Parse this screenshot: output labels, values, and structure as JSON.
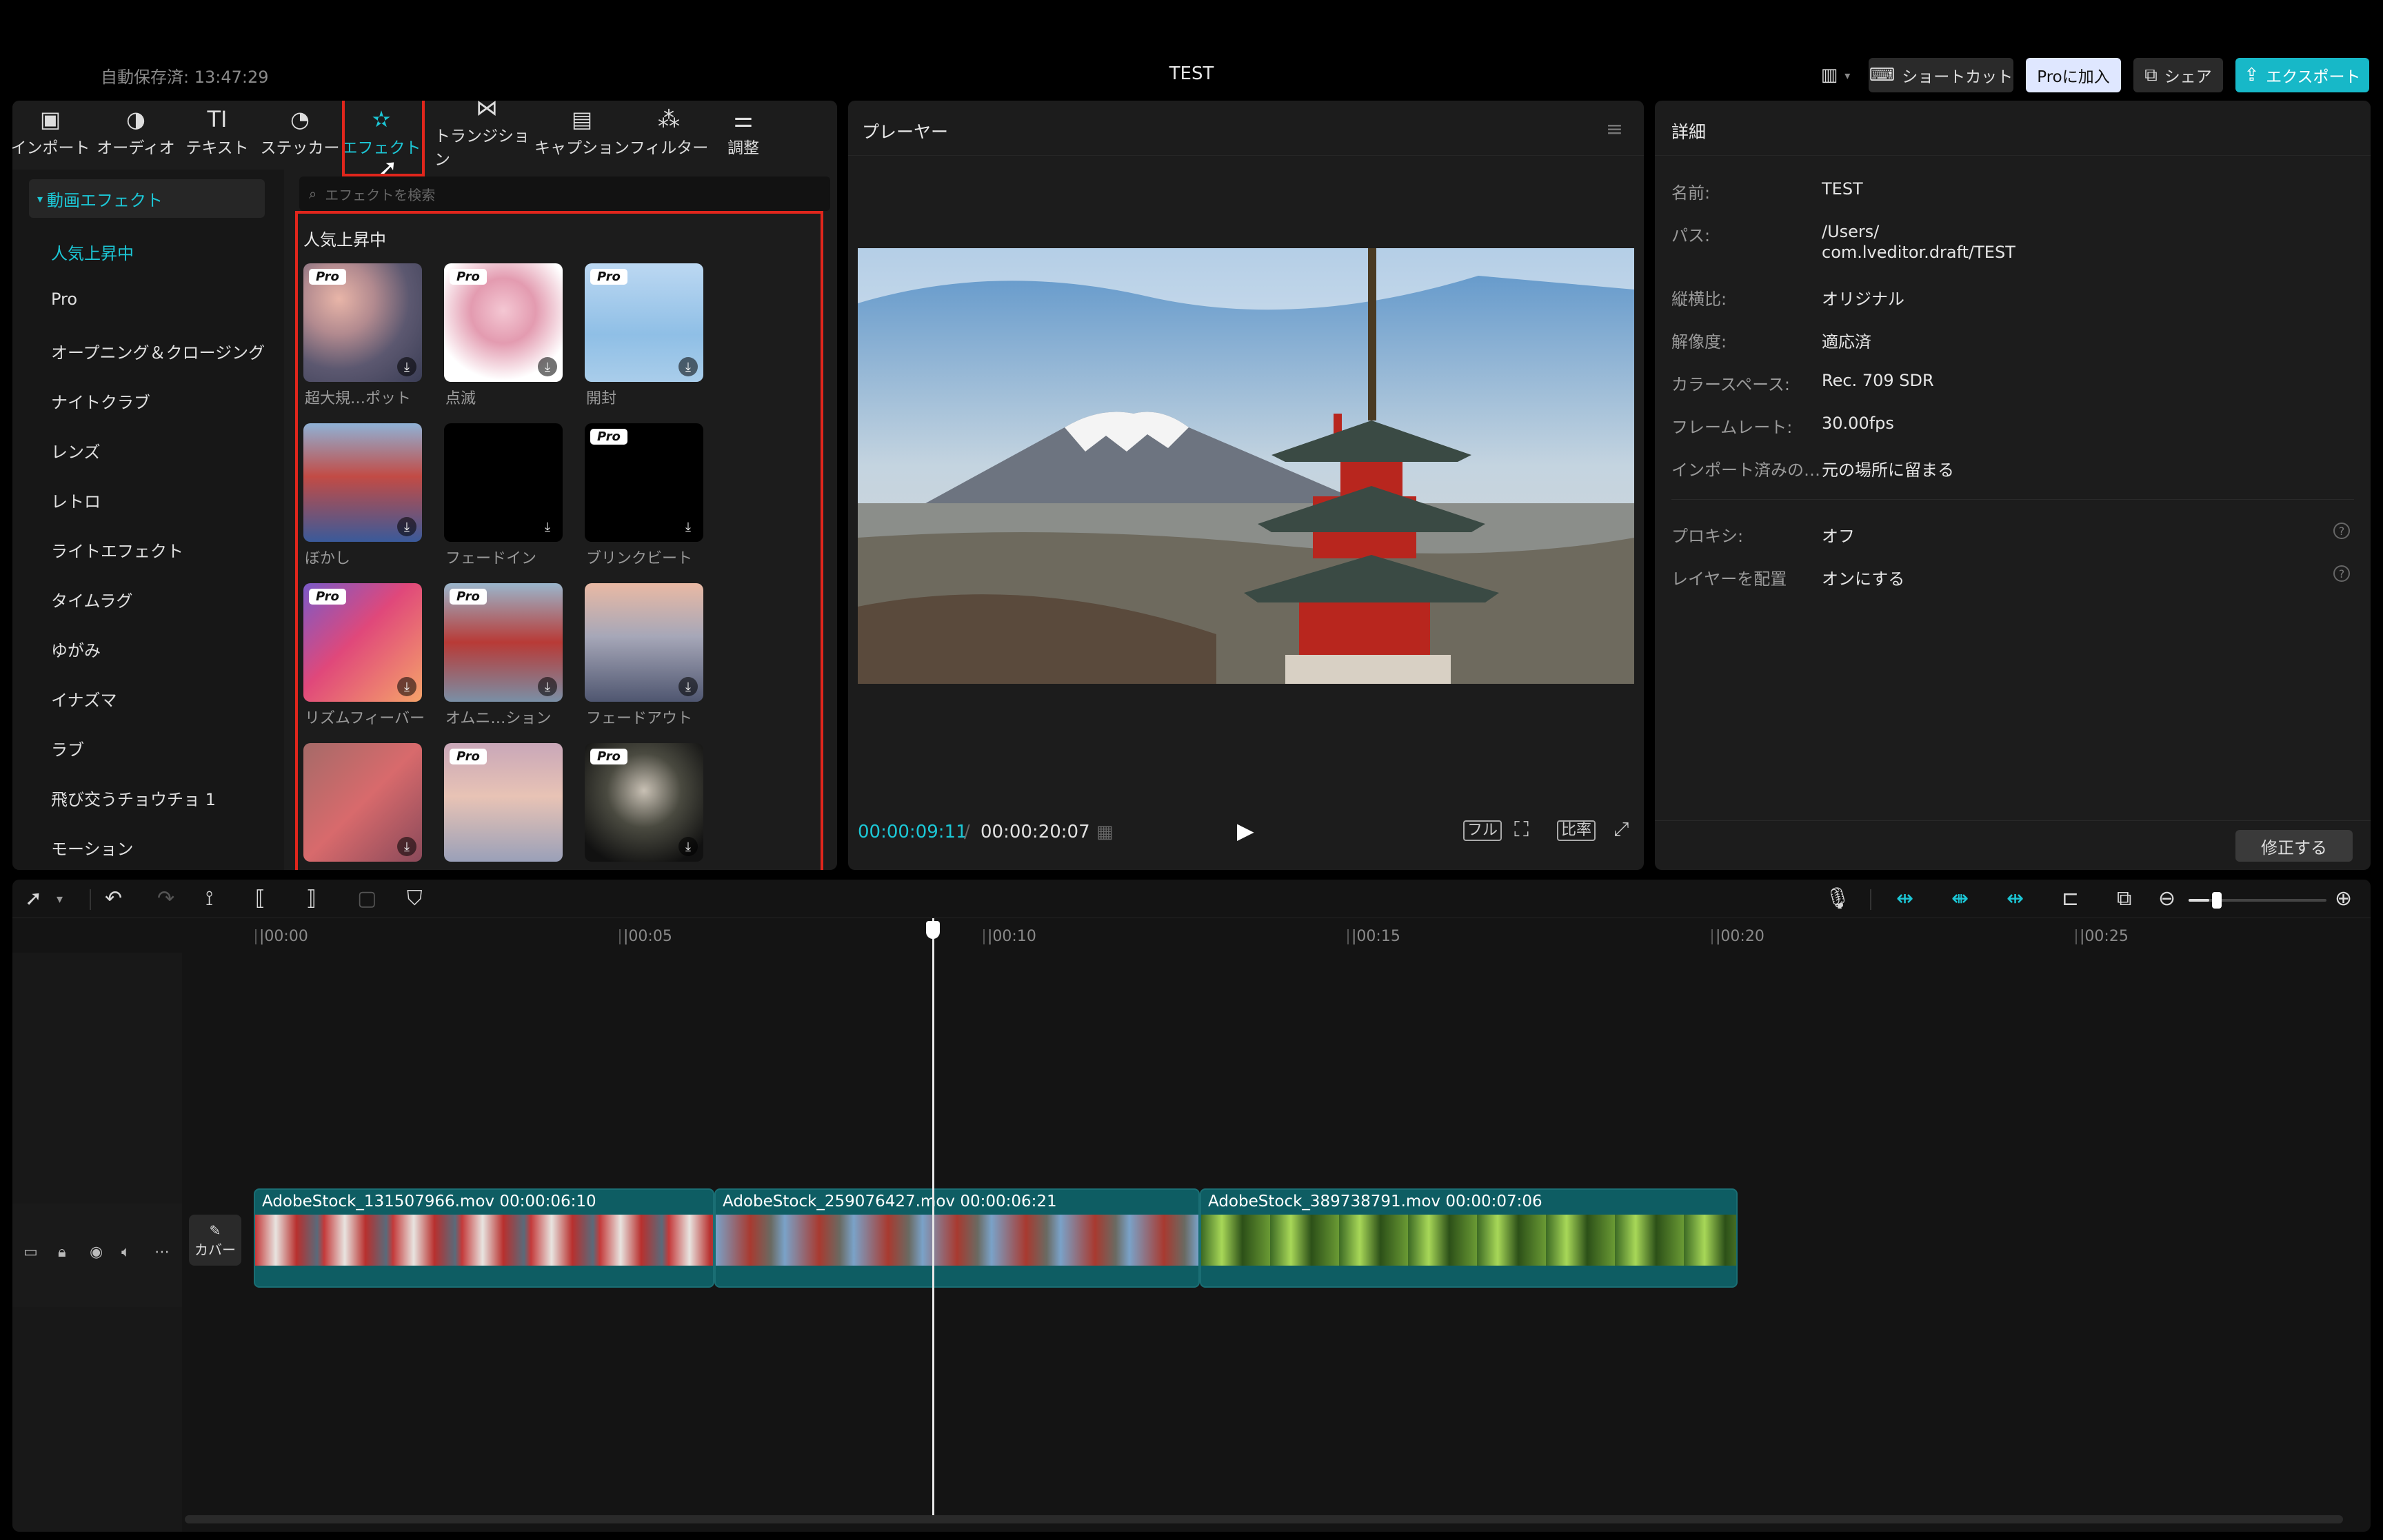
{
  "app": {
    "title": "TEST",
    "autosave": "自動保存済: 13:47:29",
    "accent": "#1cc7d6",
    "highlight": "#e0261c"
  },
  "topbar": {
    "layout_icon": "layout-icon",
    "shortcut_label": "ショートカット",
    "pro_label": "Proに加入",
    "share_label": "シェア",
    "export_label": "エクスポート"
  },
  "tool_tabs": [
    {
      "label": "インポート",
      "icon": "▣"
    },
    {
      "label": "オーディオ",
      "icon": "◑"
    },
    {
      "label": "テキスト",
      "icon": "TI"
    },
    {
      "label": "ステッカー",
      "icon": "◔"
    },
    {
      "label": "エフェクト",
      "icon": "✫"
    },
    {
      "label": "トランジション",
      "icon": "⋈"
    },
    {
      "label": "キャプション",
      "icon": "▤"
    },
    {
      "label": "フィルター",
      "icon": "⁂"
    },
    {
      "label": "調整",
      "icon": "⚌"
    }
  ],
  "sidebar": {
    "header": "動画エフェクト",
    "items": [
      "人気上昇中",
      "Pro",
      "オープニング＆クロージング",
      "ナイトクラブ",
      "レンズ",
      "レトロ",
      "ライトエフェクト",
      "タイムラグ",
      "ゆがみ",
      "イナズマ",
      "ラブ",
      "飛び交うチョウチョ 1",
      "モーション"
    ]
  },
  "search": {
    "placeholder": "エフェクトを検索"
  },
  "effects": {
    "section_title": "人気上昇中",
    "pro_badge": "Pro",
    "items": [
      {
        "label": "超大規…ポット",
        "pro": true
      },
      {
        "label": "点滅",
        "pro": true
      },
      {
        "label": "開封",
        "pro": true
      },
      {
        "label": "ぼかし",
        "pro": false
      },
      {
        "label": "フェードイン",
        "pro": false
      },
      {
        "label": "ブリンクビート",
        "pro": true
      },
      {
        "label": "リズムフィーバー",
        "pro": true
      },
      {
        "label": "オムニ…ション",
        "pro": true
      },
      {
        "label": "フェードアウト",
        "pro": false
      },
      {
        "label": "",
        "pro": false
      },
      {
        "label": "",
        "pro": true
      },
      {
        "label": "",
        "pro": true
      }
    ]
  },
  "player": {
    "title": "プレーヤー",
    "current_time": "00:00:09:11",
    "separator": "/",
    "total_time": "00:00:20:07",
    "ctrl_full": "フル",
    "ctrl_ratio": "比率"
  },
  "details": {
    "title": "詳細",
    "rows": [
      {
        "label": "名前:",
        "value": "TEST"
      },
      {
        "label": "パス:",
        "value": "/Users/",
        "value2": "com.lveditor.draft/TEST"
      },
      {
        "label": "縦横比:",
        "value": "オリジナル"
      },
      {
        "label": "解像度:",
        "value": "適応済"
      },
      {
        "label": "カラースペース:",
        "value": "Rec. 709 SDR"
      },
      {
        "label": "フレームレート:",
        "value": "30.00fps"
      },
      {
        "label": "インポート済みの…",
        "value": "元の場所に留まる"
      },
      {
        "label": "プロキシ:",
        "value": "オフ"
      },
      {
        "label": "レイヤーを配置",
        "value": "オンにする"
      }
    ],
    "modify_label": "修正する"
  },
  "timeline": {
    "ticks": [
      "|00:00",
      "|00:05",
      "|00:10",
      "|00:15",
      "|00:20",
      "|00:25"
    ],
    "cover_label": "カバー",
    "clips": [
      {
        "name": "AdobeStock_131507966.mov  00:00:06:10"
      },
      {
        "name": "AdobeStock_259076427.mov  00:00:06:21"
      },
      {
        "name": "AdobeStock_389738791.mov  00:00:07:06"
      }
    ]
  }
}
